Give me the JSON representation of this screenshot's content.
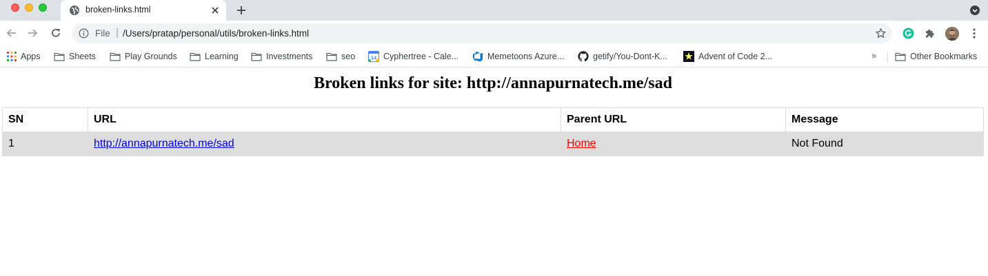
{
  "browser": {
    "tab": {
      "title": "broken-links.html"
    },
    "address": {
      "scheme": "File",
      "separator": "|",
      "url": "/Users/pratap/personal/utils/broken-links.html"
    },
    "bookmarks": {
      "items": [
        {
          "label": "Apps",
          "icon": "apps-grid-icon"
        },
        {
          "label": "Sheets",
          "icon": "folder-icon"
        },
        {
          "label": "Play Grounds",
          "icon": "folder-icon"
        },
        {
          "label": "Learning",
          "icon": "folder-icon"
        },
        {
          "label": "Investments",
          "icon": "folder-icon"
        },
        {
          "label": "seo",
          "icon": "folder-icon"
        },
        {
          "label": "Cyphertree - Cale...",
          "icon": "calendar-icon",
          "badge": "14"
        },
        {
          "label": "Memetoons Azure...",
          "icon": "azure-devops-icon"
        },
        {
          "label": "getify/You-Dont-K...",
          "icon": "github-icon"
        },
        {
          "label": "Advent of Code 2...",
          "icon": "star-icon"
        }
      ],
      "overflow": "»",
      "other": {
        "label": "Other Bookmarks",
        "icon": "folder-icon"
      }
    }
  },
  "page": {
    "title": "Broken links for site: http://annapurnatech.me/sad",
    "table": {
      "headers": [
        "SN",
        "URL",
        "Parent URL",
        "Message"
      ],
      "rows": [
        {
          "sn": "1",
          "url": "http://annapurnatech.me/sad",
          "parent": "Home",
          "message": "Not Found"
        }
      ]
    }
  },
  "colors": {
    "link": "#0000ee",
    "parent_link": "#ff0000",
    "row_background": "#dddddd",
    "tabstrip": "#dee1e6"
  }
}
